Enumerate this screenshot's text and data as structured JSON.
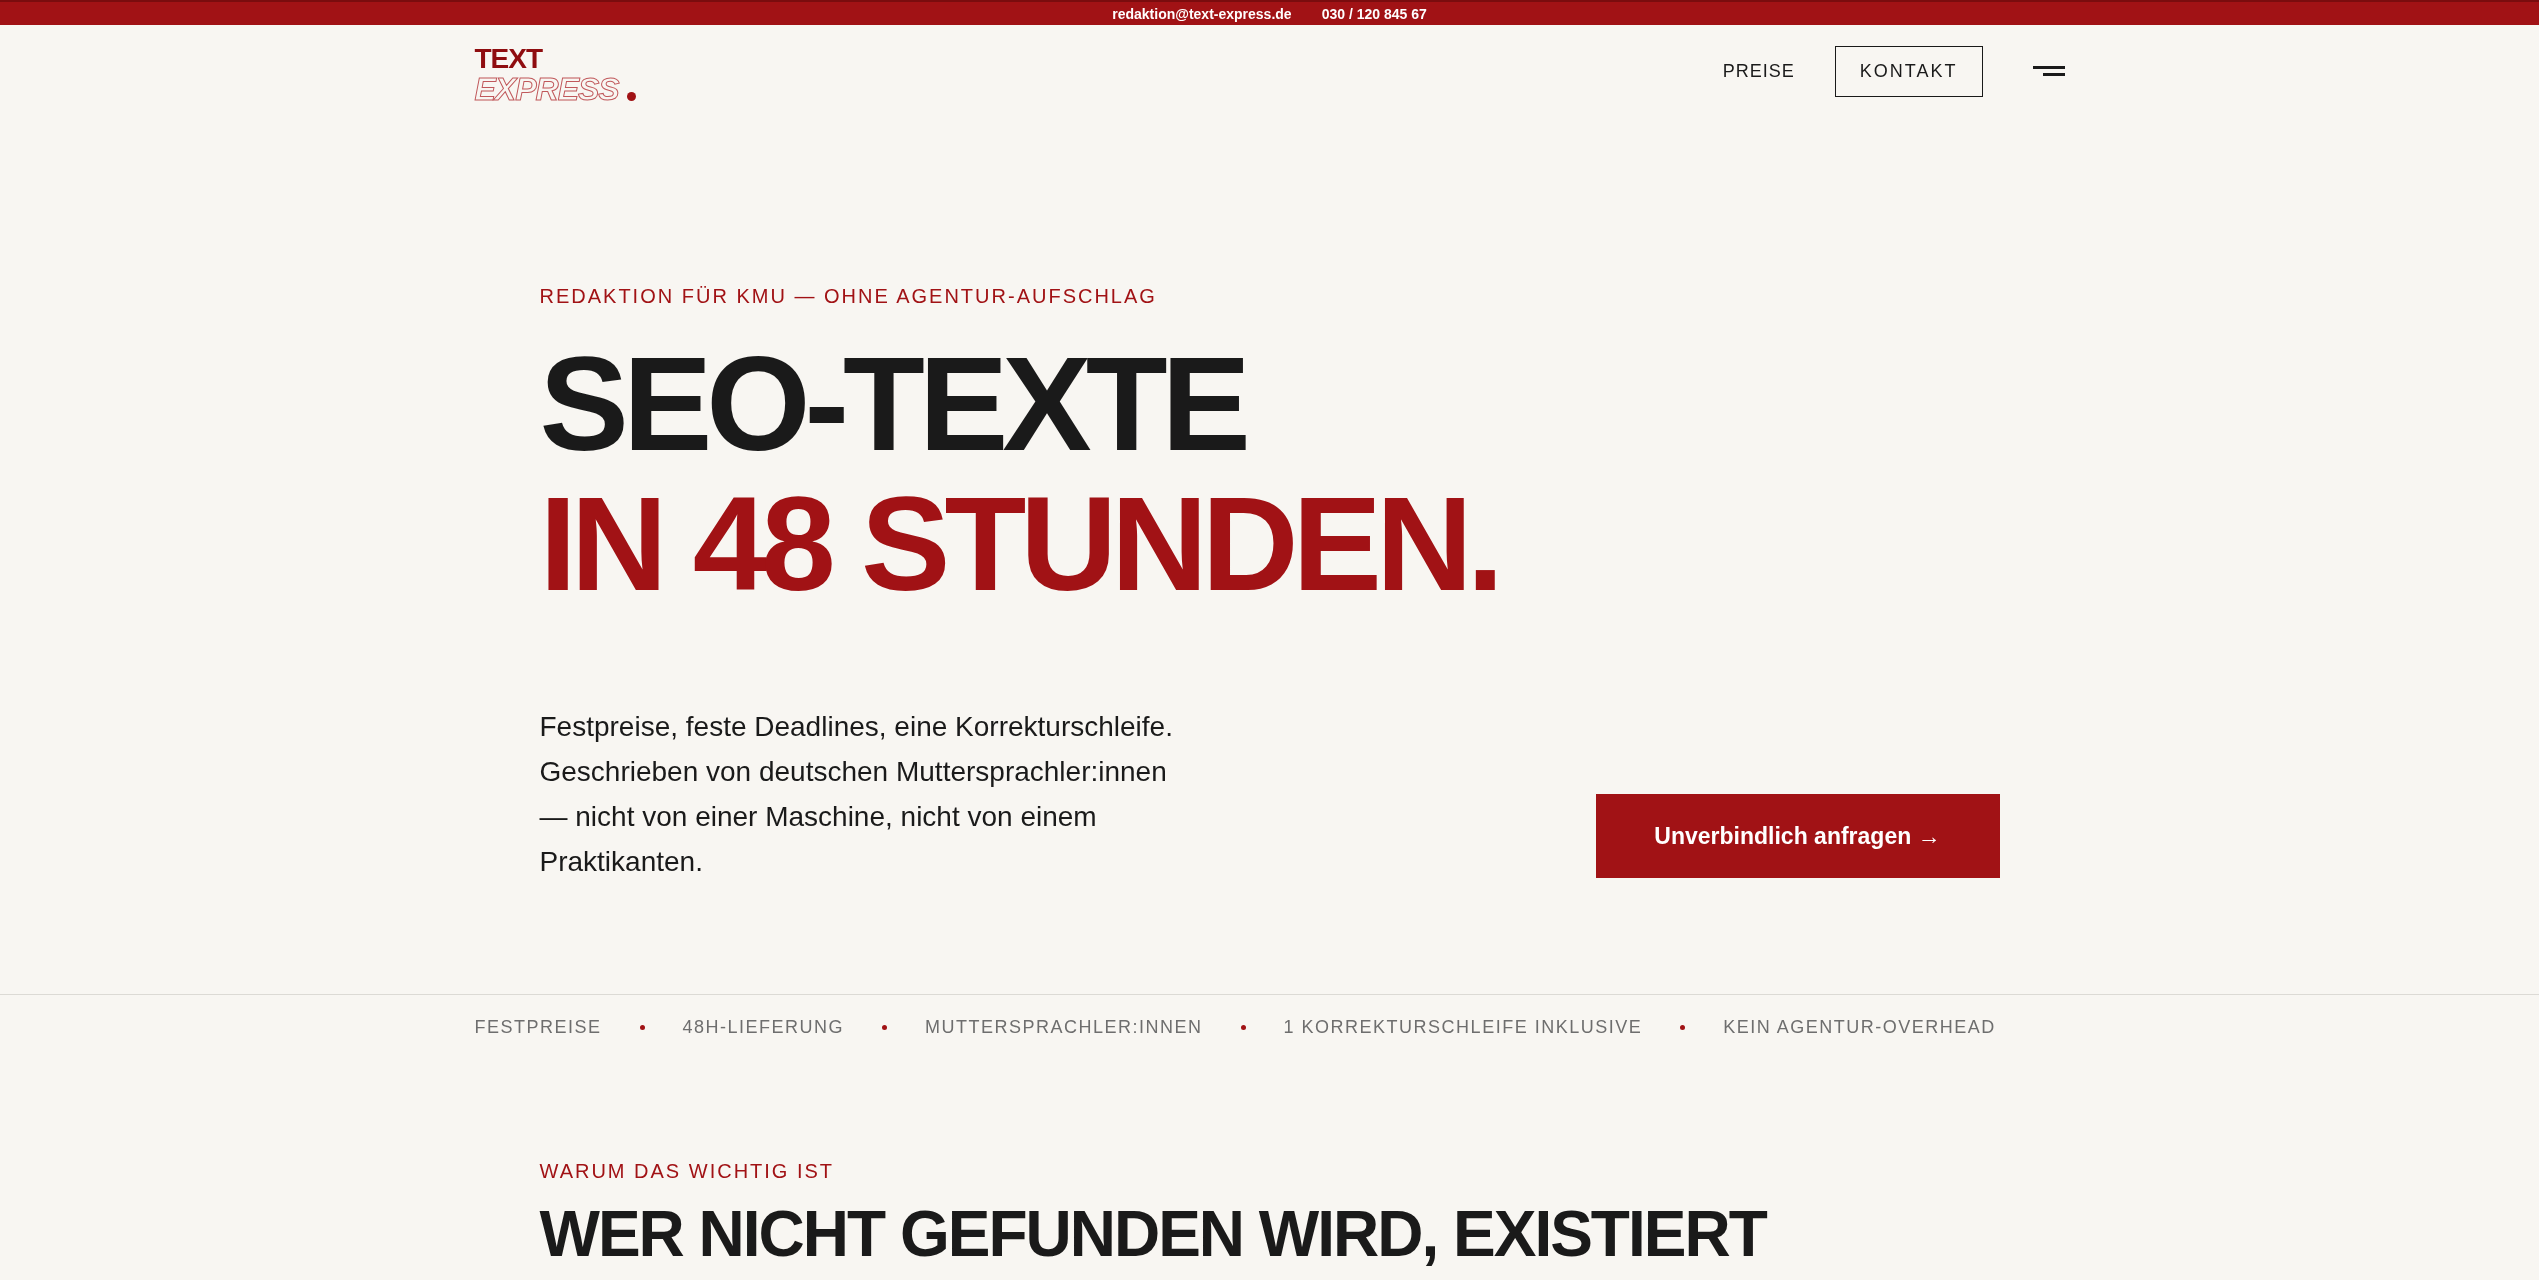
{
  "top_bar": {
    "email": "redaktion@text-express.de",
    "phone": "030 / 120 845 67"
  },
  "header": {
    "logo": {
      "line_1": "TEXT",
      "line_2": "EXPRESS"
    },
    "nav": [
      {
        "label": "PREISE",
        "kind": "link"
      },
      {
        "label": "KONTAKT",
        "kind": "button"
      }
    ]
  },
  "hero": {
    "eyebrow": "REDAKTION FÜR KMU — OHNE AGENTUR-AUFSCHLAG",
    "headline_lines": [
      {
        "text": "SEO-TEXTE",
        "accent": false
      },
      {
        "text": "IN 48 STUNDEN.",
        "accent": true
      }
    ],
    "text": "Festpreise, feste Deadlines, eine Korrekturschleife. Geschrieben von deutschen Muttersprachler:innen — nicht von einer Maschine, nicht von einem Praktikanten.",
    "cta": "Unverbindlich anfragen →"
  },
  "features": [
    "FESTPREISE",
    "48H-LIEFERUNG",
    "MUTTERSPRACHLER:INNEN",
    "1 KORREKTURSCHLEIFE INKLUSIVE",
    "KEIN AGENTUR-OVERHEAD"
  ],
  "section": {
    "eyebrow": "WARUM DAS WICHTIG IST",
    "heading": "WER NICHT GEFUNDEN WIRD, EXISTIERT"
  }
}
